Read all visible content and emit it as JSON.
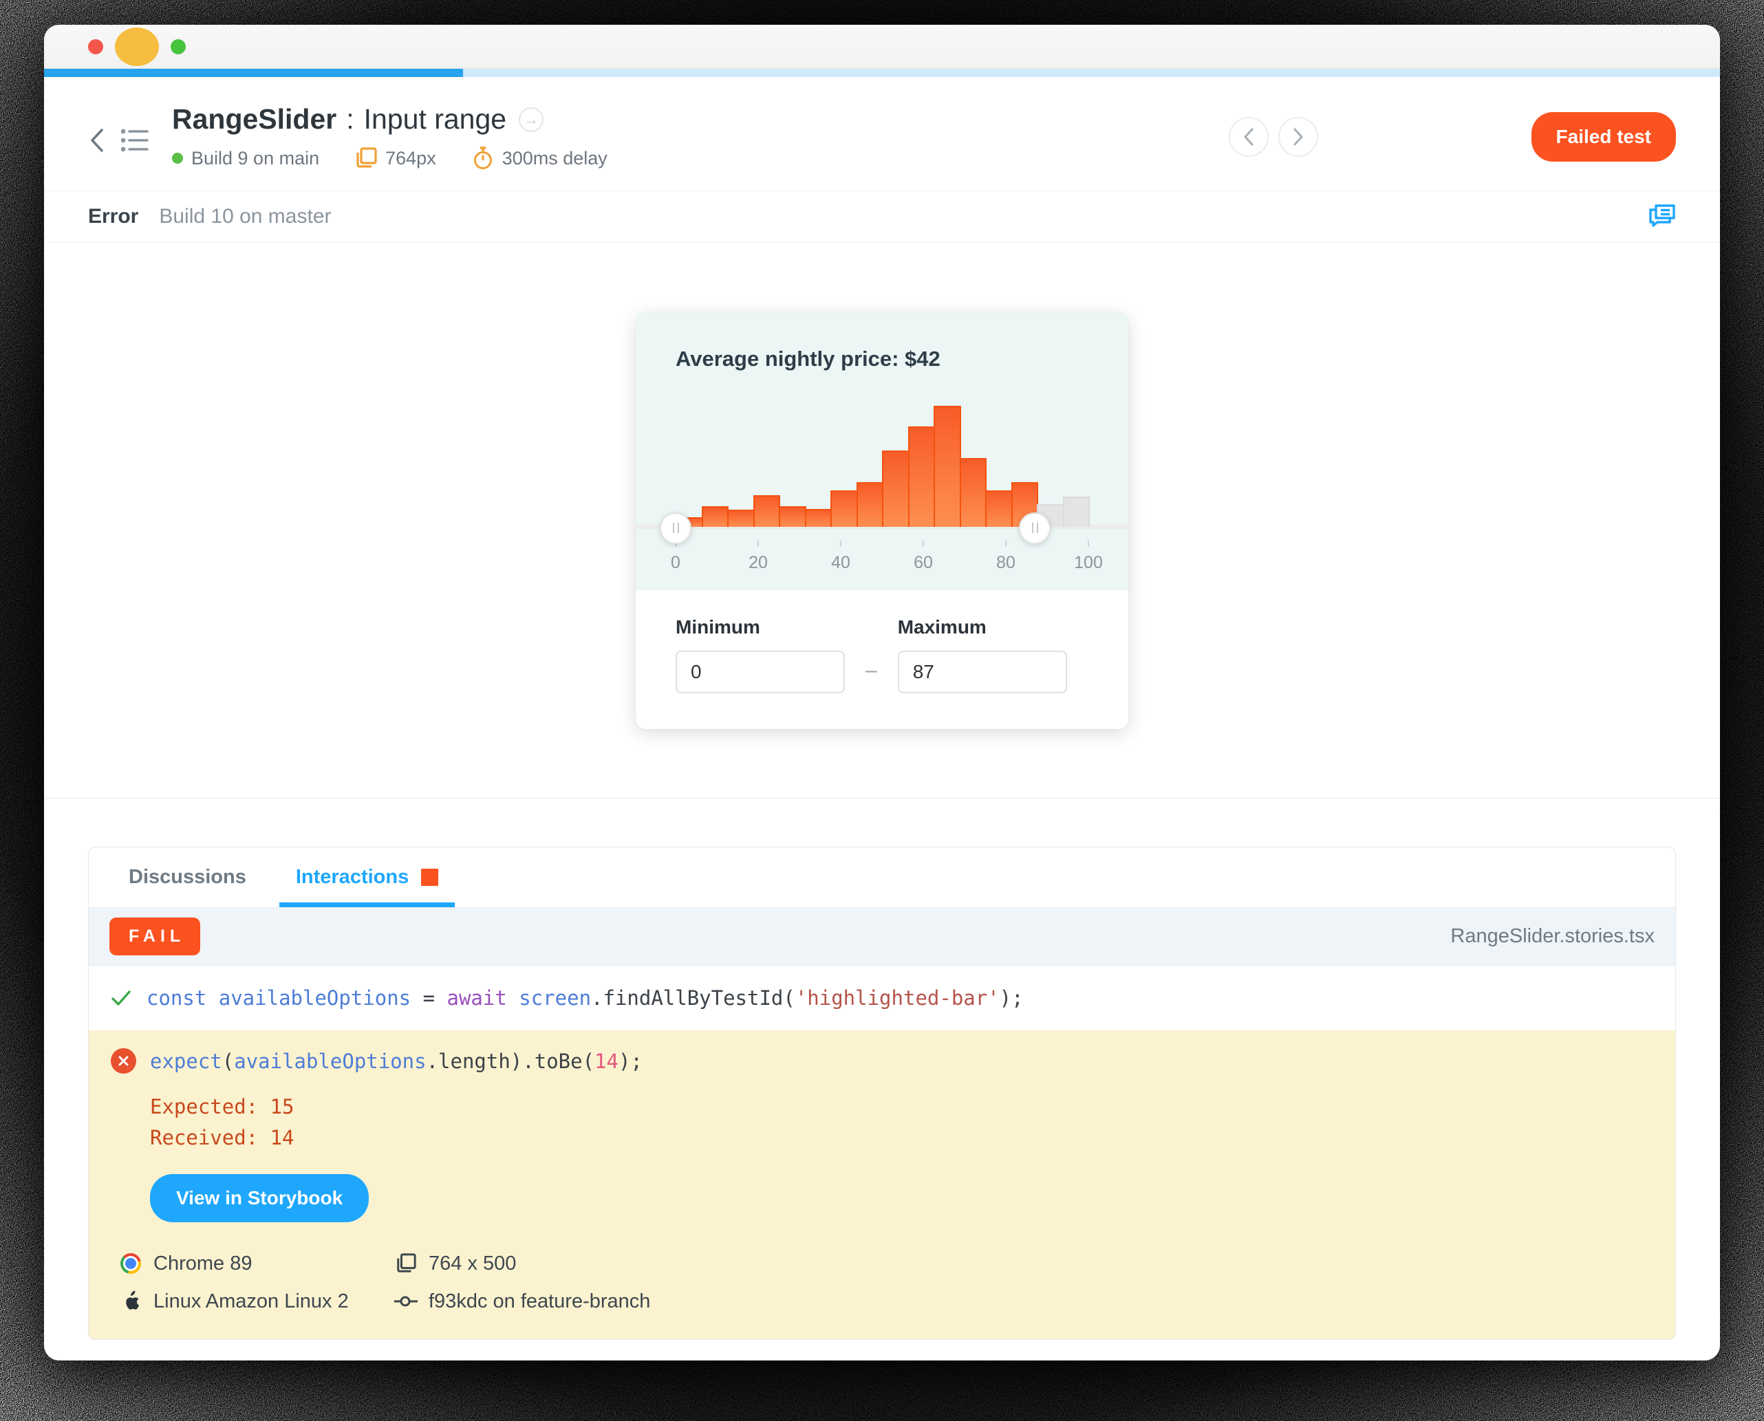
{
  "header": {
    "title_bold": "RangeSlider",
    "title_sep": ":",
    "title_rest": "Input range",
    "goto_arrow": "→",
    "build": "Build 9 on main",
    "viewport": "764px",
    "delay": "300ms delay",
    "failed_button": "Failed test"
  },
  "error_bar": {
    "label": "Error",
    "build": "Build 10 on master"
  },
  "component": {
    "title": "Average nightly price: $42",
    "min_label": "Minimum",
    "min_value": "0",
    "max_label": "Maximum",
    "max_value": "87",
    "dash": "–"
  },
  "chart_data": {
    "type": "bar",
    "title": "Average nightly price: $42",
    "x_range": [
      0,
      100
    ],
    "x_ticks": [
      0,
      20,
      40,
      60,
      80,
      100
    ],
    "bins": "16 equal bins spanning 0–100",
    "values_pct_of_max": [
      8,
      17,
      14,
      26,
      17,
      15,
      30,
      37,
      63,
      83,
      100,
      57,
      30,
      37,
      19,
      25
    ],
    "highlighted_count": 14,
    "highlight_color": "#fc521f",
    "muted_color": "#e4e4e4",
    "slider": {
      "min": 0,
      "max": 87
    },
    "grid": false,
    "legend": false
  },
  "tabs": {
    "discussions": "Discussions",
    "interactions": "Interactions"
  },
  "interactions": {
    "status": "FAIL",
    "file": "RangeSlider.stories.tsx",
    "code1": [
      {
        "t": "const ",
        "c": "blue"
      },
      {
        "t": "availableOptions ",
        "c": "blue"
      },
      {
        "t": "= ",
        "c": "plain"
      },
      {
        "t": "await ",
        "c": "purple"
      },
      {
        "t": "screen",
        "c": "blue"
      },
      {
        "t": ".findAllByTestId(",
        "c": "plain"
      },
      {
        "t": "'highlighted-bar'",
        "c": "str"
      },
      {
        "t": ");",
        "c": "plain"
      }
    ],
    "code2": [
      {
        "t": "expect",
        "c": "blue"
      },
      {
        "t": "(",
        "c": "plain"
      },
      {
        "t": "availableOptions",
        "c": "blue"
      },
      {
        "t": ".length).toBe(",
        "c": "plain"
      },
      {
        "t": "14",
        "c": "num"
      },
      {
        "t": ");",
        "c": "plain"
      }
    ],
    "expected": "Expected: 15",
    "received": "Received: 14",
    "storybook_button": "View in Storybook",
    "browser": "Chrome 89",
    "os": "Linux Amazon Linux 2",
    "size": "764 x 500",
    "commit": "f93kdc on feature-branch"
  },
  "colors": {
    "accent_orange": "#fc521f",
    "accent_blue": "#1ea7fd",
    "fail_yellow_bg": "#fbf2cf",
    "chart_bg": "#ebf6f5"
  }
}
